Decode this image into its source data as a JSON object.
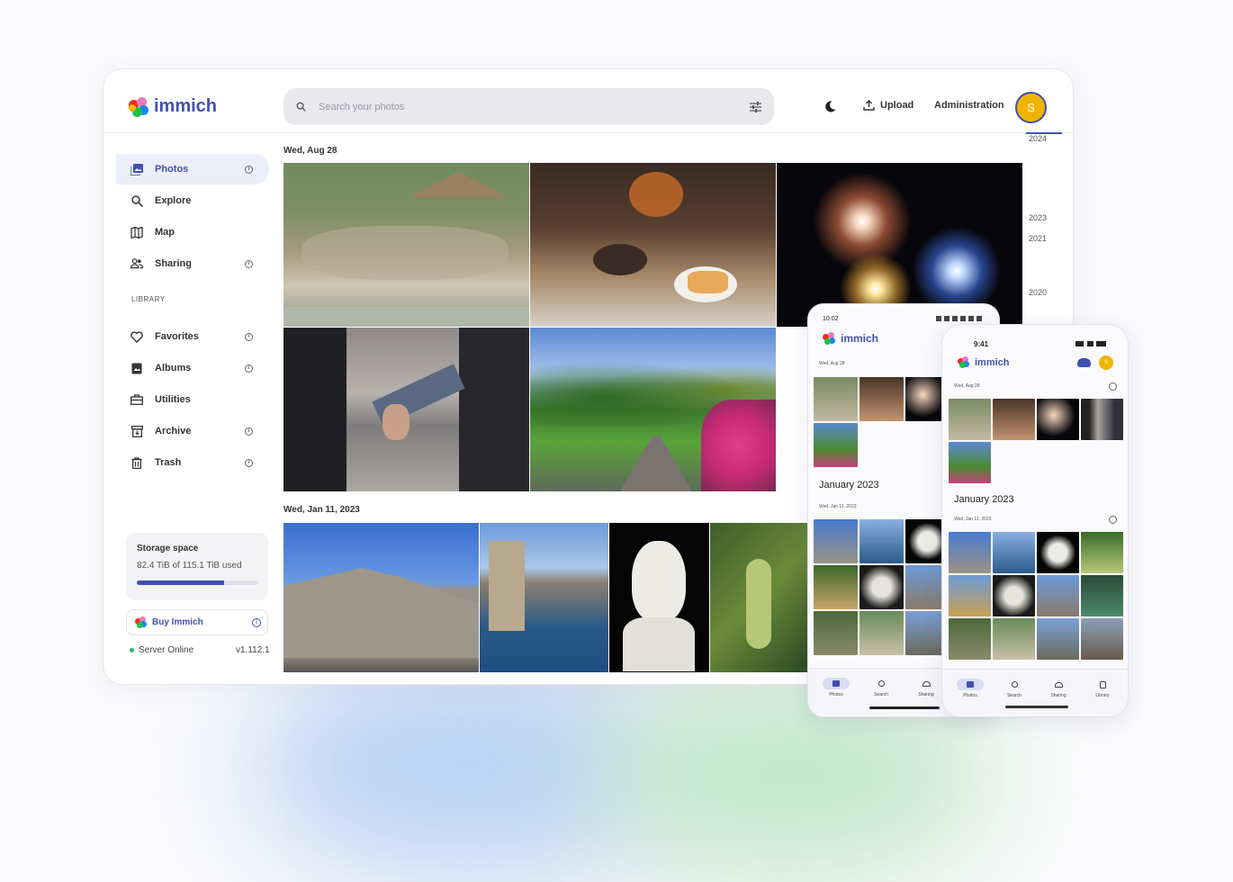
{
  "app": {
    "name": "immich"
  },
  "search": {
    "placeholder": "Search your photos"
  },
  "header": {
    "upload": "Upload",
    "administration": "Administration",
    "avatar_initial": "S"
  },
  "sidebar": {
    "items": [
      {
        "label": "Photos"
      },
      {
        "label": "Explore"
      },
      {
        "label": "Map"
      },
      {
        "label": "Sharing"
      }
    ],
    "library_label": "LIBRARY",
    "library_items": [
      {
        "label": "Favorites"
      },
      {
        "label": "Albums"
      },
      {
        "label": "Utilities"
      },
      {
        "label": "Archive"
      },
      {
        "label": "Trash"
      }
    ],
    "storage": {
      "title": "Storage space",
      "usage": "82.4 TiB of 115.1 TiB used",
      "used_fraction": 0.716
    },
    "buy": "Buy Immich",
    "server_status": "Server Online",
    "version": "v1.112.1"
  },
  "timeline": {
    "groups": [
      {
        "date": "Wed, Aug 28"
      },
      {
        "date": "Wed, Jan 11, 2023"
      }
    ],
    "scrubber_years": [
      "2024",
      "2023",
      "2021",
      "2020"
    ]
  },
  "phone_android": {
    "time": "10:02",
    "app_name": "immich",
    "date1": "Wed, Aug 28",
    "month": "January 2023",
    "date2": "Wed, Jan 11, 2023",
    "tabs": [
      "Photos",
      "Search",
      "Sharing"
    ]
  },
  "phone_ios": {
    "time": "9:41",
    "app_name": "immich",
    "avatar_initial": "S",
    "date1": "Wed, Aug 28",
    "month": "January 2023",
    "date2": "Wed, Jan 11, 2023",
    "tabs": [
      "Photos",
      "Search",
      "Sharing",
      "Library"
    ]
  },
  "colors": {
    "accent": "#4250af",
    "avatar": "#f0b400",
    "online": "#2eb56a"
  }
}
